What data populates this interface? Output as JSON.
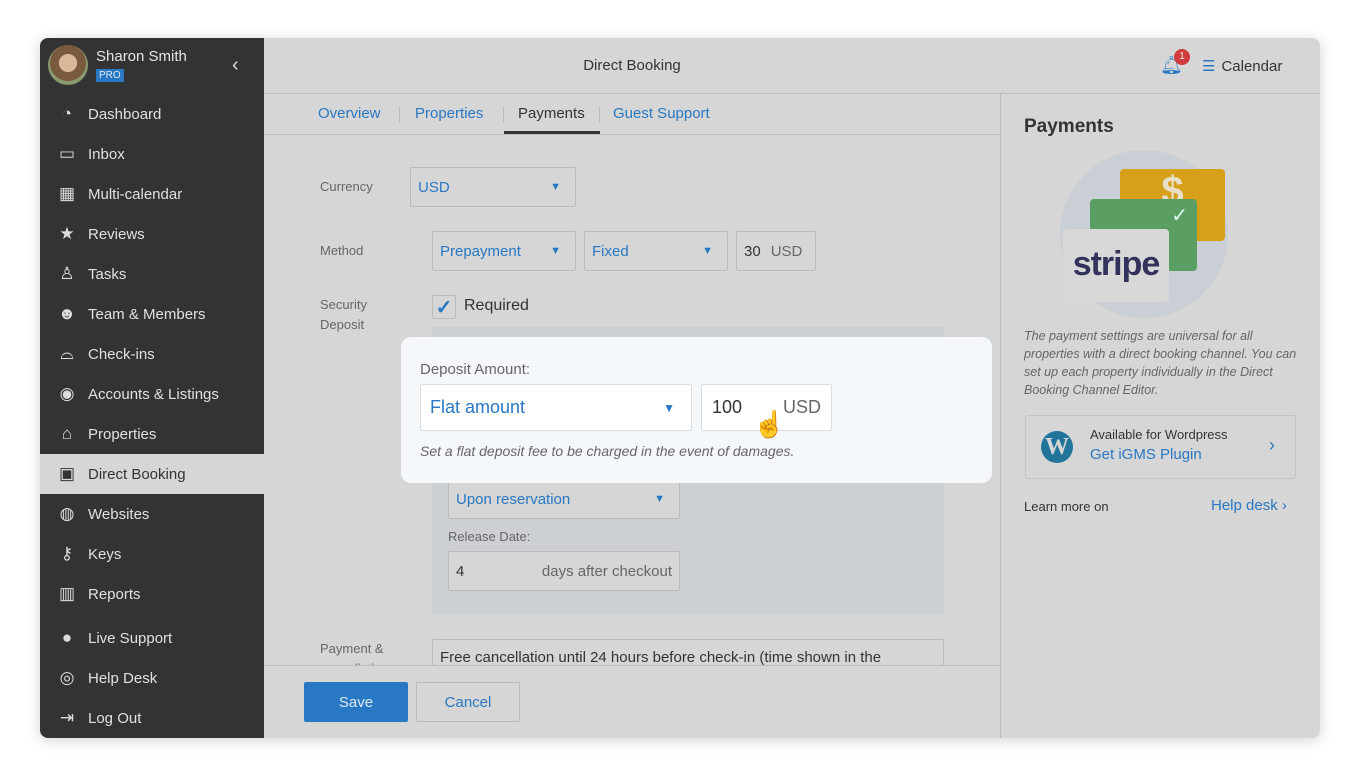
{
  "user": {
    "name": "Sharon Smith",
    "plan_badge": "PRO"
  },
  "sidebar": {
    "items": [
      {
        "label": "Dashboard",
        "icon": "gauge-icon"
      },
      {
        "label": "Inbox",
        "icon": "inbox-icon"
      },
      {
        "label": "Multi-calendar",
        "icon": "calendar-icon"
      },
      {
        "label": "Reviews",
        "icon": "star-icon"
      },
      {
        "label": "Tasks",
        "icon": "broom-icon"
      },
      {
        "label": "Team & Members",
        "icon": "users-icon"
      },
      {
        "label": "Check-ins",
        "icon": "bell-service-icon"
      },
      {
        "label": "Accounts & Listings",
        "icon": "user-circle-icon"
      },
      {
        "label": "Properties",
        "icon": "home-icon"
      },
      {
        "label": "Direct Booking",
        "icon": "browser-code-icon",
        "active": true
      },
      {
        "label": "Websites",
        "icon": "globe-icon"
      },
      {
        "label": "Keys",
        "icon": "key-icon"
      },
      {
        "label": "Reports",
        "icon": "bar-chart-icon"
      },
      {
        "label": "Live Support",
        "icon": "chat-icon"
      },
      {
        "label": "Help Desk",
        "icon": "lifebuoy-icon"
      },
      {
        "label": "Log Out",
        "icon": "logout-icon"
      }
    ]
  },
  "header": {
    "title": "Direct Booking",
    "notifications": "1",
    "calendar_label": "Calendar"
  },
  "tabs": [
    "Overview",
    "Properties",
    "Payments",
    "Guest Support"
  ],
  "form": {
    "currency_label": "Currency",
    "currency": "USD",
    "method_label": "Method",
    "method": "Prepayment",
    "method_type": "Fixed",
    "method_amount": "30",
    "method_unit": "USD",
    "security_label_1": "Security",
    "security_label_2": "Deposit",
    "required_label": "Required",
    "required": true,
    "charge_when": "Upon reservation",
    "release_label": "Release Date:",
    "release_days": "4",
    "release_unit": "days after checkout",
    "policy_label_1": "Payment &",
    "policy_label_2": "cancellation",
    "policy_text": "Free cancellation until 24 hours before check-in (time shown in the"
  },
  "popup": {
    "label": "Deposit Amount:",
    "type": "Flat amount",
    "amount": "100",
    "unit": "USD",
    "hint": "Set a flat deposit fee to be charged in the event of damages."
  },
  "footer": {
    "save": "Save",
    "cancel": "Cancel"
  },
  "right_panel": {
    "title": "Payments",
    "logo_text": "stripe",
    "description": "The payment settings are universal for all properties with a direct booking channel. You can set up each property individually in the Direct Booking Channel Editor.",
    "plugin_caption": "Available for Wordpress",
    "plugin_link": "Get iGMS Plugin",
    "learn_more": "Learn more on",
    "help_link": "Help desk"
  },
  "colors": {
    "accent": "#2878c3",
    "sidebar": "#333333",
    "badge": "#d13b3b"
  }
}
